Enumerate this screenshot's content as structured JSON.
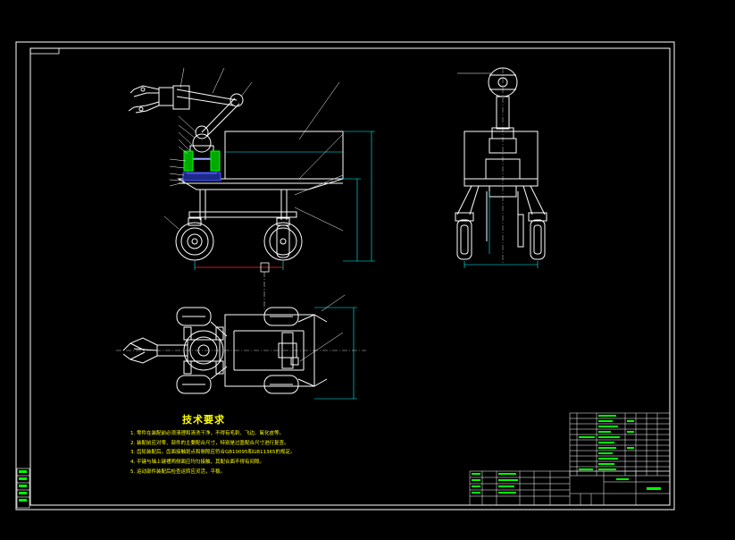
{
  "drawing": {
    "colors": {
      "background": "#000000",
      "frame": "#ffffff",
      "outline": "#ffffff",
      "dimension": "#00ffff",
      "hatch": "#4a5bff",
      "accent_green": "#00ff00",
      "text_yellow": "#ffff00",
      "centerline": "#ff2a2a"
    },
    "technical_requirements": {
      "title": "技术要求",
      "items": [
        "1. 零件在装配前必须清理和清洗干净，不得有毛刺、飞边、氧化皮等。",
        "2. 装配前应对零、部件的主要配合尺寸，特别是过盈配合尺寸进行复查。",
        "3. 齿轮装配后，齿面接触斑点和侧隙应符合GB10095和GB11365的规定。",
        "4. 平键与轴上键槽两侧面应均匀接触，其配合面不得有间隙。",
        "5. 运动部件装配后检查运转应灵活，平稳。"
      ]
    }
  }
}
